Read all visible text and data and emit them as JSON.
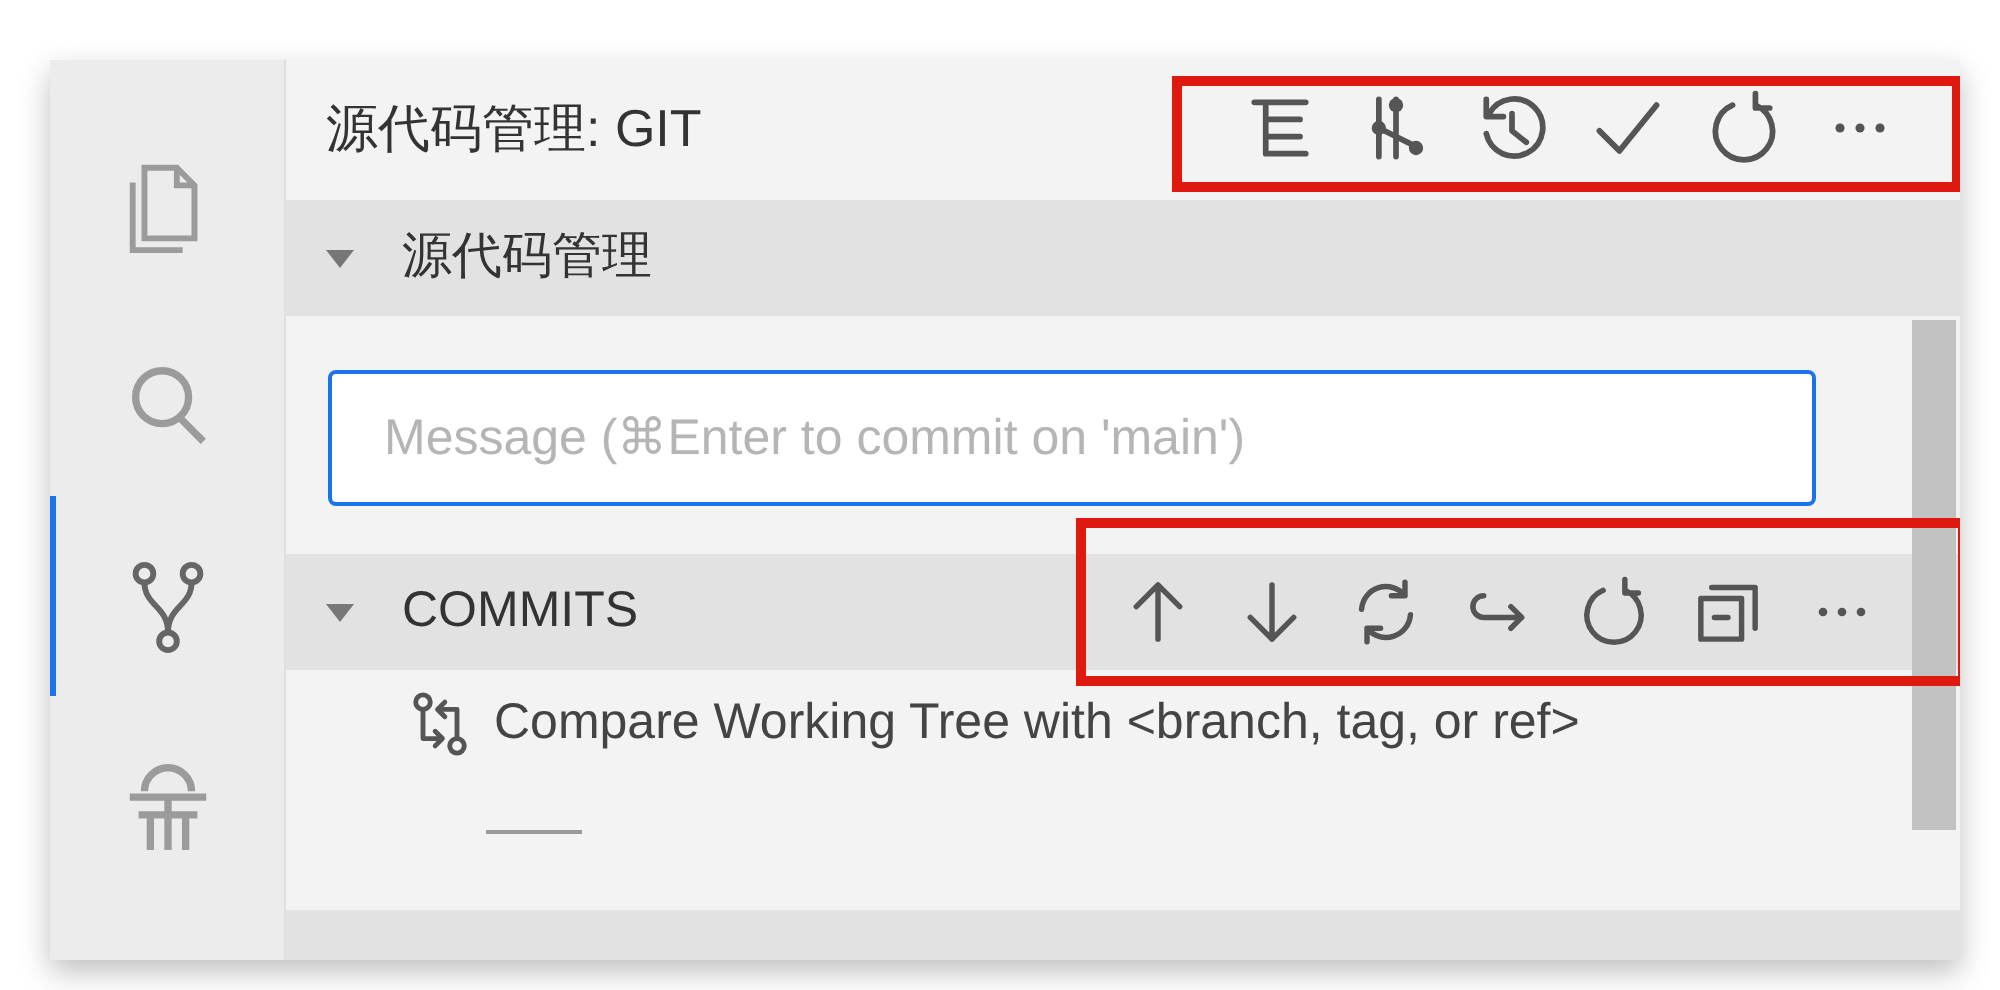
{
  "activity_bar": {
    "items": [
      {
        "kind": "files",
        "selected": false
      },
      {
        "kind": "search",
        "selected": false
      },
      {
        "kind": "scm",
        "selected": true
      },
      {
        "kind": "debug",
        "selected": false
      }
    ]
  },
  "panel": {
    "title": "源代码管理: GIT",
    "title_actions": [
      {
        "kind": "tree"
      },
      {
        "kind": "graph"
      },
      {
        "kind": "history"
      },
      {
        "kind": "check"
      },
      {
        "kind": "refresh"
      },
      {
        "kind": "more"
      }
    ]
  },
  "sections": [
    {
      "kind": "changes",
      "title": "源代码管理",
      "expanded": true
    },
    {
      "kind": "commits",
      "title": "COMMITS",
      "expanded": true,
      "actions": [
        {
          "kind": "up"
        },
        {
          "kind": "down"
        },
        {
          "kind": "sync"
        },
        {
          "kind": "forward"
        },
        {
          "kind": "refresh"
        },
        {
          "kind": "collapse"
        },
        {
          "kind": "more"
        }
      ]
    },
    {
      "kind": "repositories"
    }
  ],
  "commit_message": {
    "placeholder": "Message (⌘Enter to commit on 'main')"
  },
  "commits_items": [
    {
      "label": "Compare Working Tree with <branch, tag, or ref>"
    }
  ]
}
